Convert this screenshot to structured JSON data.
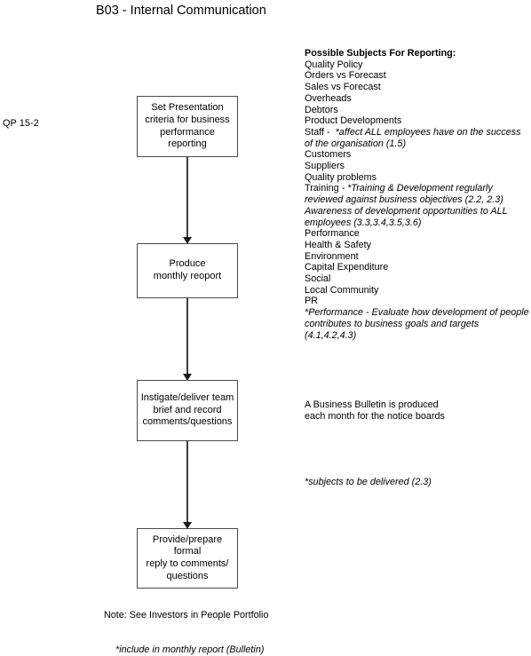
{
  "document": {
    "title": "B03 - Internal Communication",
    "side_tag": "QP 15-2"
  },
  "flowchart": {
    "boxes": [
      {
        "id": "box-1",
        "lines": [
          "Set Presentation",
          "criteria for business",
          "performance",
          "reporting"
        ]
      },
      {
        "id": "box-2",
        "lines": [
          "Produce",
          "monthly reoport"
        ]
      },
      {
        "id": "box-3",
        "lines": [
          "Instigate/deliver team",
          "brief and record",
          "comments/questions"
        ]
      },
      {
        "id": "box-4",
        "lines": [
          "Provide/prepare",
          "formal",
          "reply to comments/",
          "questions"
        ]
      }
    ],
    "connectors": [
      {
        "from": "box-1",
        "to": "box-2"
      },
      {
        "from": "box-2",
        "to": "box-3"
      },
      {
        "from": "box-3",
        "to": "box-4"
      }
    ]
  },
  "subjects_panel": {
    "heading": "Possible Subjects For Reporting:",
    "items": [
      {
        "text": "Quality Policy",
        "style": "normal"
      },
      {
        "text": "Orders vs Forecast",
        "style": "normal"
      },
      {
        "text": "Sales vs Forecast",
        "style": "normal"
      },
      {
        "text": "Overheads",
        "style": "normal"
      },
      {
        "text": "Debtors",
        "style": "normal"
      },
      {
        "text": "Product Developments",
        "style": "normal"
      },
      {
        "lead": "Staff -  ",
        "text": "*affect ALL employees have on the success of the organisation (1.5)",
        "style": "italic"
      },
      {
        "text": "Customers",
        "style": "normal"
      },
      {
        "text": "Suppliers",
        "style": "normal"
      },
      {
        "text": "Quality problems",
        "style": "normal"
      },
      {
        "lead": "Training - ",
        "text": "*Training & Development regularly reviewed against business objectives (2.2, 2.3)",
        "style": "italic"
      },
      {
        "text": "Awareness of development opportunities to ALL employees (3.3,3.4,3.5,3.6)",
        "style": "italic"
      },
      {
        "text": "Performance",
        "style": "normal"
      },
      {
        "text": "Health & Safety",
        "style": "normal"
      },
      {
        "text": "Environment",
        "style": "normal"
      },
      {
        "text": "Capital Expenditure",
        "style": "normal"
      },
      {
        "text": "Social",
        "style": "normal"
      },
      {
        "text": "Local Community",
        "style": "normal"
      },
      {
        "text": "PR",
        "style": "normal"
      },
      {
        "text": "*Performance - Evaluate how development of people contributes to business goals and targets (4.1,4.2,4.3)",
        "style": "italic"
      }
    ]
  },
  "annotations": {
    "bulletin_note": "A Business Bulletin is produced\neach month for the notice boards",
    "subjects_note": "*subjects to be delivered  (2.3)",
    "portfolio_note": "Note: See Investors in People Portfolio",
    "include_note": "*include in monthly report (Bulletin)"
  }
}
